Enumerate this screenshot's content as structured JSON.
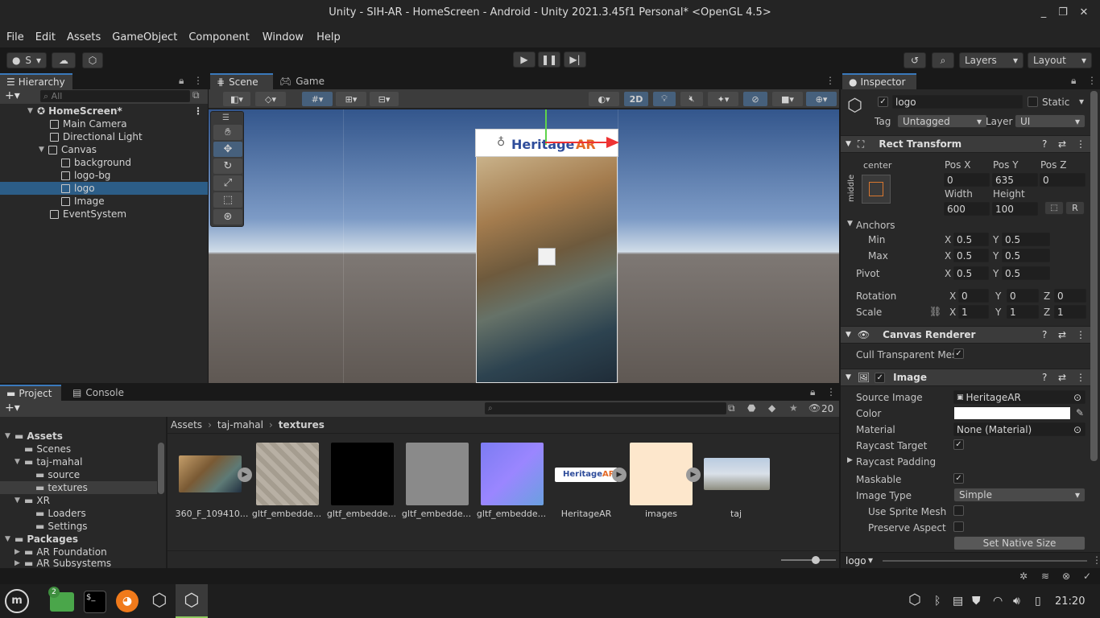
{
  "window": {
    "title": "Unity - SIH-AR - HomeScreen - Android - Unity 2021.3.45f1 Personal* <OpenGL 4.5>",
    "min": "_",
    "max": "❐",
    "close": "✕"
  },
  "menu": [
    "File",
    "Edit",
    "Assets",
    "GameObject",
    "Component",
    "Window",
    "Help"
  ],
  "toolbar": {
    "account": "S",
    "layers": "Layers",
    "layout": "Layout"
  },
  "hierarchy": {
    "tab": "Hierarchy",
    "search_placeholder": "All",
    "scene": "HomeScreen*",
    "items": [
      "Main Camera",
      "Directional Light",
      "Canvas",
      "background",
      "logo-bg",
      "logo",
      "Image",
      "EventSystem"
    ]
  },
  "scene": {
    "tab_scene": "Scene",
    "tab_game": "Game",
    "mode_2d": "2D",
    "logo_text_1": "Heritage",
    "logo_text_2": "AR"
  },
  "inspector": {
    "tab": "Inspector",
    "object_name": "logo",
    "static": "Static",
    "tag_label": "Tag",
    "tag": "Untagged",
    "layer_label": "Layer",
    "layer": "UI",
    "rect": {
      "title": "Rect Transform",
      "anchor_h": "center",
      "anchor_v": "middle",
      "posx_l": "Pos X",
      "posy_l": "Pos Y",
      "posz_l": "Pos Z",
      "posx": "0",
      "posy": "635",
      "posz": "0",
      "width_l": "Width",
      "height_l": "Height",
      "width": "600",
      "height": "100",
      "r": "R",
      "anchors": "Anchors",
      "min": "Min",
      "max": "Max",
      "pivot": "Pivot",
      "min_x": "0.5",
      "min_y": "0.5",
      "max_x": "0.5",
      "max_y": "0.5",
      "pivot_x": "0.5",
      "pivot_y": "0.5",
      "rotation": "Rotation",
      "scale": "Scale",
      "rot_x": "0",
      "rot_y": "0",
      "rot_z": "0",
      "sc_x": "1",
      "sc_y": "1",
      "sc_z": "1",
      "x": "X",
      "y": "Y",
      "z": "Z"
    },
    "canvas_renderer": {
      "title": "Canvas Renderer",
      "cull": "Cull Transparent Mes"
    },
    "image": {
      "title": "Image",
      "source_l": "Source Image",
      "source": "HeritageAR",
      "color_l": "Color",
      "material_l": "Material",
      "material": "None (Material)",
      "raycast_l": "Raycast Target",
      "padding_l": "Raycast Padding",
      "maskable_l": "Maskable",
      "type_l": "Image Type",
      "type": "Simple",
      "sprite_mesh_l": "Use Sprite Mesh",
      "preserve_l": "Preserve Aspect",
      "native_btn": "Set Native Size"
    },
    "footer": "logo"
  },
  "project": {
    "tab_project": "Project",
    "tab_console": "Console",
    "hidden_count": "20",
    "tree": [
      {
        "label": "Assets",
        "bold": true
      },
      {
        "label": "Scenes"
      },
      {
        "label": "taj-mahal"
      },
      {
        "label": "source"
      },
      {
        "label": "textures"
      },
      {
        "label": "XR"
      },
      {
        "label": "Loaders"
      },
      {
        "label": "Settings"
      },
      {
        "label": "Packages",
        "bold": true
      },
      {
        "label": "AR Foundation"
      },
      {
        "label": "AR Subsystems"
      }
    ],
    "breadcrumb": [
      "Assets",
      "taj-mahal",
      "textures"
    ],
    "files": [
      "360_F_109410...",
      "gltf_embedde...",
      "gltf_embedde...",
      "gltf_embedde...",
      "gltf_embedde...",
      "HeritageAR",
      "images",
      "taj"
    ]
  },
  "taskbar": {
    "files_badge": "2",
    "terminal": "$_",
    "time": "21:20"
  }
}
